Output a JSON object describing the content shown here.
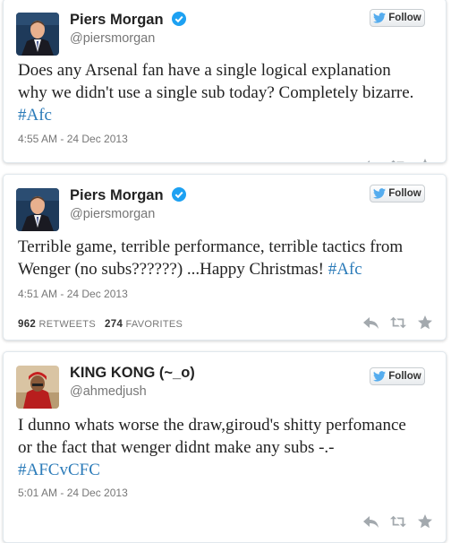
{
  "tweets": [
    {
      "name": "Piers Morgan",
      "handle": "@piersmorgan",
      "verified": true,
      "follow_label": "Follow",
      "text_lines": [
        "Does any Arsenal fan have a single logical explanation",
        "why we didn't use a single sub today? Completely bizarre."
      ],
      "hashtag": "#Afc",
      "time": "4:55 AM - 24 Dec 2013"
    },
    {
      "name": "Piers Morgan",
      "handle": "@piersmorgan",
      "verified": true,
      "follow_label": "Follow",
      "text_lines": [
        "Terrible game, terrible performance, terrible tactics from",
        "Wenger (no subs??????) ...Happy Christmas!"
      ],
      "hashtag": "#Afc",
      "time": "4:51 AM - 24 Dec 2013",
      "retweets": "962",
      "retweets_label": "RETWEETS",
      "favorites": "274",
      "favorites_label": "FAVORITES"
    },
    {
      "name": "KING KONG (~_o)",
      "handle": "@ahmedjush",
      "verified": false,
      "follow_label": "Follow",
      "text_lines": [
        "I dunno whats worse the draw,giroud's shitty perfomance",
        "or the fact that wenger didnt make any subs -.-"
      ],
      "hashtag": "#AFCvCFC",
      "time": "5:01 AM - 24 Dec 2013"
    }
  ],
  "icons": {
    "verified": "verified-badge-icon",
    "follow": "twitter-bird-icon",
    "reply": "reply-icon",
    "retweet": "retweet-icon",
    "favorite": "star-icon"
  },
  "colors": {
    "hashtag": "#2b7bb9",
    "verified": "#1da1f2",
    "bird": "#55acee",
    "action_icons": "#a3a9ae"
  }
}
